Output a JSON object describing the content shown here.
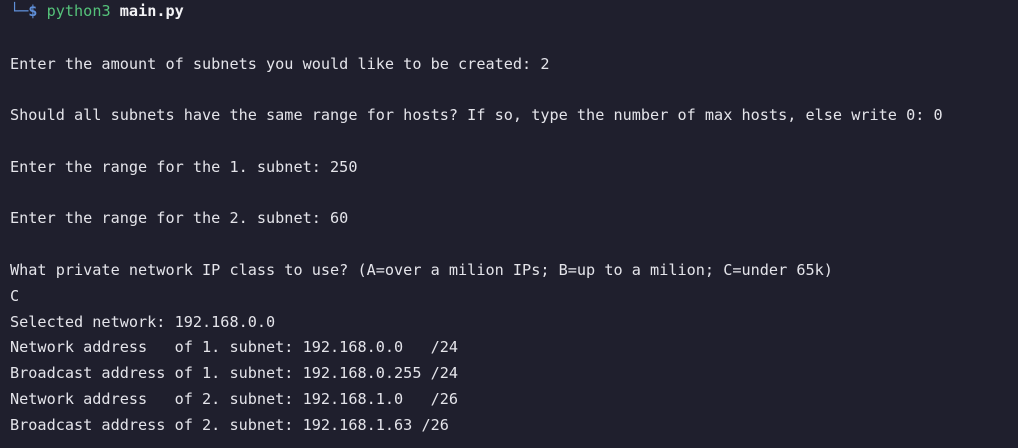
{
  "prompt": {
    "corner": "└─",
    "symbol": "$",
    "command": "python3",
    "argument": "main.py"
  },
  "output": {
    "q_subnets": "Enter the amount of subnets you would like to be created: 2",
    "q_same_range": "Should all subnets have the same range for hosts? If so, type the number of max hosts, else write 0: 0",
    "q_range_1": "Enter the range for the 1. subnet: 250",
    "q_range_2": "Enter the range for the 2. subnet: 60",
    "q_class": "What private network IP class to use? (A=over a milion IPs; B=up to a milion; C=under 65k)",
    "answer_class": "C",
    "selected_network": "Selected network: 192.168.0.0",
    "net_addr_1": "Network address   of 1. subnet: 192.168.0.0   /24",
    "bcast_addr_1": "Broadcast address of 1. subnet: 192.168.0.255 /24",
    "net_addr_2": "Network address   of 2. subnet: 192.168.1.0   /26",
    "bcast_addr_2": "Broadcast address of 2. subnet: 192.168.1.63 /26"
  },
  "colors": {
    "background": "#1f1f2d",
    "text": "#e4e4ea",
    "prompt_accent": "#5f8fd8",
    "command": "#55c27a"
  }
}
